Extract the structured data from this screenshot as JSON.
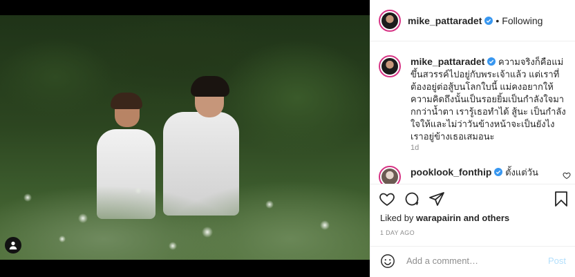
{
  "header": {
    "username": "mike_pattaradet",
    "dot": "•",
    "follow_status": "Following"
  },
  "caption": {
    "username": "mike_pattaradet",
    "text": "ความจริงก็คือแม่ขึ้นสวรรค์ไปอยู่กับพระเจ้าแล้ว แต่เราที่ต้องอยู่ต่อสู้บนโลกใบนี้ แม่คงอยากให้ความคิดถึงนั้นเป็นรอยยิ้มเป็นกำลังใจมากกว่าน้ำตา เรารู้เธอทำได้ สู้นะ เป็นกำลังใจให้และไม่ว่าวันข้างหน้าจะเป็นยังไง เราอยู่ข้างเธอเสมอนะ",
    "time": "1d"
  },
  "comment": {
    "username": "pooklook_fonthip",
    "text": "ตั้งแต่วัน"
  },
  "likes": {
    "prefix": "Liked by ",
    "user": "warapairin",
    "suffix": " and others"
  },
  "time_ago": "1 DAY AGO",
  "add_comment": {
    "placeholder": "Add a comment…",
    "post_label": "Post"
  },
  "colors": {
    "verified": "#3897f0",
    "post_disabled": "#b2dffc",
    "story_ring": "#d63384"
  }
}
